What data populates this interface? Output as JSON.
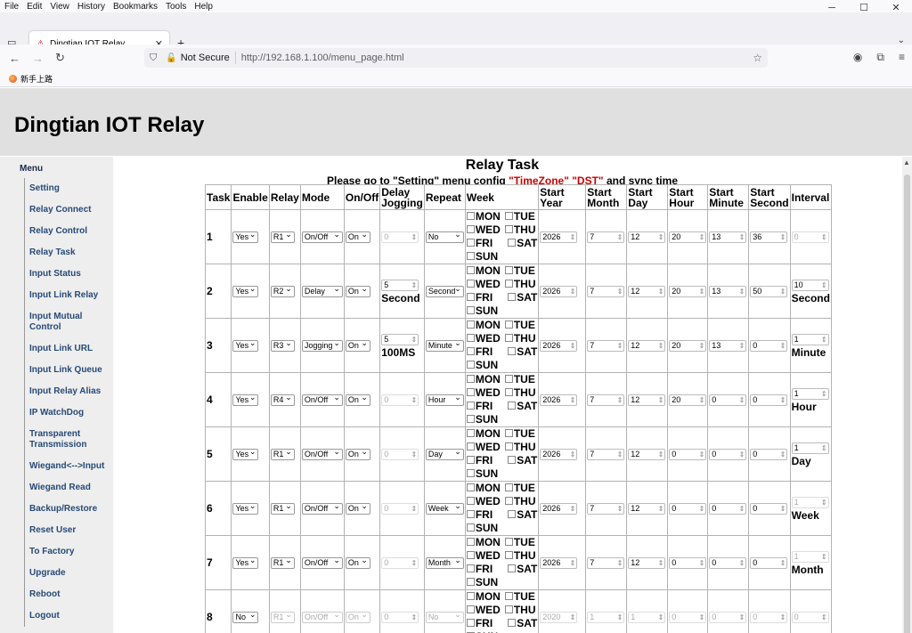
{
  "browser": {
    "menu": [
      "File",
      "Edit",
      "View",
      "History",
      "Bookmarks",
      "Tools",
      "Help"
    ],
    "tab_title": "Dingtian IOT Relay",
    "security": "Not Secure",
    "url": "http://192.168.1.100/menu_page.html",
    "bookmark": "新手上路"
  },
  "header": {
    "title": "Dingtian IOT Relay"
  },
  "sidebar": {
    "title": "Menu",
    "items": [
      "Setting",
      "Relay Connect",
      "Relay Control",
      "Relay Task",
      "Input Status",
      "Input Link Relay",
      "Input Mutual Control",
      "Input Link URL",
      "Input Link Queue",
      "Input Relay Alias",
      "IP WatchDog",
      "Transparent Transmission",
      "Wiegand<-->Input",
      "Wiegand Read",
      "Backup/Restore",
      "Reset User",
      "To Factory",
      "Upgrade",
      "Reboot",
      "Logout"
    ]
  },
  "main": {
    "title": "Relay Task",
    "subtitle_pre": "Please go to \"Setting\" menu config ",
    "subtitle_tz": "\"TimeZone\" \"DST\"",
    "subtitle_post": " and sync time",
    "headers": [
      "Task",
      "Enable",
      "Relay",
      "Mode",
      "On/Off",
      "Delay Jogging",
      "Repeat",
      "Week",
      "Start Year",
      "Start Month",
      "Start Day",
      "Start Hour",
      "Start Minute",
      "Start Second",
      "Interval"
    ],
    "week_days": [
      "MON",
      "TUE",
      "WED",
      "THU",
      "FRI",
      "SAT",
      "SUN"
    ],
    "rows": [
      {
        "task": "1",
        "enable": "Yes",
        "relay": "R1",
        "mode": "On/Off",
        "onoff": "On",
        "delay": "0",
        "delay_unit": "",
        "repeat": "No",
        "year": "2026",
        "month": "7",
        "day": "12",
        "hour": "20",
        "minute": "13",
        "second": "36",
        "interval": "0",
        "interval_unit": ""
      },
      {
        "task": "2",
        "enable": "Yes",
        "relay": "R2",
        "mode": "Delay",
        "onoff": "On",
        "delay": "5",
        "delay_unit": "Second",
        "repeat": "Second",
        "year": "2026",
        "month": "7",
        "day": "12",
        "hour": "20",
        "minute": "13",
        "second": "50",
        "interval": "10",
        "interval_unit": "Second"
      },
      {
        "task": "3",
        "enable": "Yes",
        "relay": "R3",
        "mode": "Jogging",
        "onoff": "On",
        "delay": "5",
        "delay_unit": "100MS",
        "repeat": "Minute",
        "year": "2026",
        "month": "7",
        "day": "12",
        "hour": "20",
        "minute": "13",
        "second": "0",
        "interval": "1",
        "interval_unit": "Minute"
      },
      {
        "task": "4",
        "enable": "Yes",
        "relay": "R4",
        "mode": "On/Off",
        "onoff": "On",
        "delay": "0",
        "delay_unit": "",
        "repeat": "Hour",
        "year": "2026",
        "month": "7",
        "day": "12",
        "hour": "20",
        "minute": "0",
        "second": "0",
        "interval": "1",
        "interval_unit": "Hour"
      },
      {
        "task": "5",
        "enable": "Yes",
        "relay": "R1",
        "mode": "On/Off",
        "onoff": "On",
        "delay": "0",
        "delay_unit": "",
        "repeat": "Day",
        "year": "2026",
        "month": "7",
        "day": "12",
        "hour": "0",
        "minute": "0",
        "second": "0",
        "interval": "1",
        "interval_unit": "Day"
      },
      {
        "task": "6",
        "enable": "Yes",
        "relay": "R1",
        "mode": "On/Off",
        "onoff": "On",
        "delay": "0",
        "delay_unit": "",
        "repeat": "Week",
        "year": "2026",
        "month": "7",
        "day": "12",
        "hour": "0",
        "minute": "0",
        "second": "0",
        "interval": "1",
        "interval_unit": "Week"
      },
      {
        "task": "7",
        "enable": "Yes",
        "relay": "R1",
        "mode": "On/Off",
        "onoff": "On",
        "delay": "0",
        "delay_unit": "",
        "repeat": "Month",
        "year": "2026",
        "month": "7",
        "day": "12",
        "hour": "0",
        "minute": "0",
        "second": "0",
        "interval": "1",
        "interval_unit": "Month"
      },
      {
        "task": "8",
        "enable": "No",
        "relay": "R1",
        "mode": "On/Off",
        "onoff": "On",
        "delay": "0",
        "delay_unit": "",
        "repeat": "No",
        "year": "2020",
        "month": "1",
        "day": "1",
        "hour": "0",
        "minute": "0",
        "second": "0",
        "interval": "0",
        "interval_unit": ""
      }
    ]
  }
}
